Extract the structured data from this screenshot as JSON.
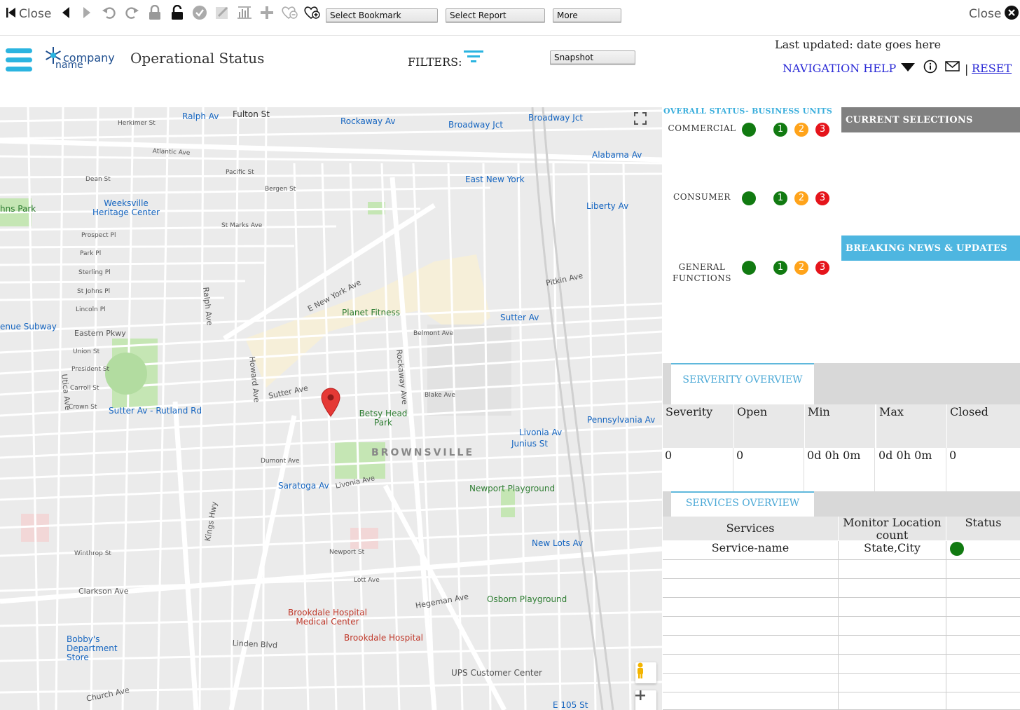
{
  "toolbar": {
    "close_left": "Close",
    "close_right": "Close",
    "select_bookmark": "Select Bookmark",
    "select_report": "Select Report",
    "more": "More"
  },
  "header": {
    "logo_line1": "company",
    "logo_line2": "name",
    "title": "Operational Status",
    "filters_label": "FILTERS:",
    "snapshot": "Snapshot",
    "last_updated": "Last updated: date goes here",
    "nav_help": "NAVIGATION HELP",
    "separator": "|",
    "reset": "RESET"
  },
  "map": {
    "neighborhood": "BROWNSVILLE",
    "places": [
      {
        "name": "Ralph Av",
        "kind": "transit"
      },
      {
        "name": "Fulton St",
        "kind": "street"
      },
      {
        "name": "Rockaway Av",
        "kind": "transit"
      },
      {
        "name": "Broadway Jct",
        "kind": "transit"
      },
      {
        "name": "Broadway Jct",
        "kind": "transit"
      },
      {
        "name": "Alabama Av",
        "kind": "transit"
      },
      {
        "name": "East New York",
        "kind": "transit"
      },
      {
        "name": "Weeksville Heritage Center",
        "kind": "poi"
      },
      {
        "name": "Liberty Av",
        "kind": "transit"
      },
      {
        "name": "Planet Fitness",
        "kind": "poi"
      },
      {
        "name": "Sutter Av",
        "kind": "transit"
      },
      {
        "name": "Betsy Head Park",
        "kind": "poi"
      },
      {
        "name": "Sutter Av - Rutland Rd",
        "kind": "transit"
      },
      {
        "name": "Livonia Av",
        "kind": "transit"
      },
      {
        "name": "Junius St",
        "kind": "transit"
      },
      {
        "name": "Pennsylvania Av",
        "kind": "transit"
      },
      {
        "name": "Saratoga Av",
        "kind": "transit"
      },
      {
        "name": "Newport Playground",
        "kind": "poi"
      },
      {
        "name": "New Lots Av",
        "kind": "transit"
      },
      {
        "name": "Osborn Playground",
        "kind": "poi"
      },
      {
        "name": "Brookdale Hospital Medical Center",
        "kind": "hospital"
      },
      {
        "name": "Brookdale Hospital",
        "kind": "hospital"
      },
      {
        "name": "Bobby's Department Store",
        "kind": "transit"
      },
      {
        "name": "UPS Customer Center",
        "kind": "street"
      },
      {
        "name": "E 105 St",
        "kind": "transit"
      },
      {
        "name": "enue Subway",
        "kind": "transit"
      },
      {
        "name": "hns Park",
        "kind": "poi"
      }
    ],
    "streets": [
      "Atlantic Ave",
      "Herkimer St",
      "Pacific St",
      "Dean St",
      "Bergen St",
      "St Marks Ave",
      "Prospect Pl",
      "Park Pl",
      "Sterling Pl",
      "St Johns Pl",
      "Lincoln Pl",
      "Eastern Pkwy",
      "E New York Ave",
      "Pitkin Ave",
      "Belmont Ave",
      "Sutter Ave",
      "Blake Ave",
      "Dumont Ave",
      "Livonia Ave",
      "Newport St",
      "Hegeman Ave",
      "Linden Blvd",
      "Clarkson Ave",
      "Church Ave",
      "Rockaway Ave",
      "Ralph Ave",
      "Utica Ave",
      "Howard Ave",
      "Union St",
      "President St",
      "Carroll St",
      "Crown St",
      "Winthrop St",
      "Lott Ave",
      "Kings Hwy"
    ]
  },
  "status": {
    "title": "OVERALL STATUS- BUSINESS UNITS",
    "units": [
      {
        "label_1": "COMMERCIAL",
        "label_2": ""
      },
      {
        "label_1": "CONSUMER",
        "label_2": ""
      },
      {
        "label_1": "GENERAL",
        "label_2": "FUNCTIONS"
      }
    ],
    "levels": [
      "1",
      "2",
      "3"
    ],
    "colors": {
      "green": "#117a11",
      "orange": "#ffa31a",
      "red": "#e5141b"
    }
  },
  "current_selections": "CURRENT SELECTIONS",
  "breaking_news": "BREAKING NEWS & UPDATES",
  "severity": {
    "tab": "SERVERITY OVERVIEW",
    "columns": [
      "Severity",
      "Open",
      "Min",
      "Max",
      "Closed"
    ],
    "values": [
      "0",
      "0",
      "0d 0h 0m",
      "0d 0h 0m",
      "0"
    ]
  },
  "services": {
    "tab": "SERVICES OVERVIEW",
    "columns": [
      "Services",
      "Monitor Location count",
      "Status"
    ],
    "rows": [
      {
        "service": "Service-name",
        "location": "State,City",
        "status": "green"
      }
    ]
  }
}
